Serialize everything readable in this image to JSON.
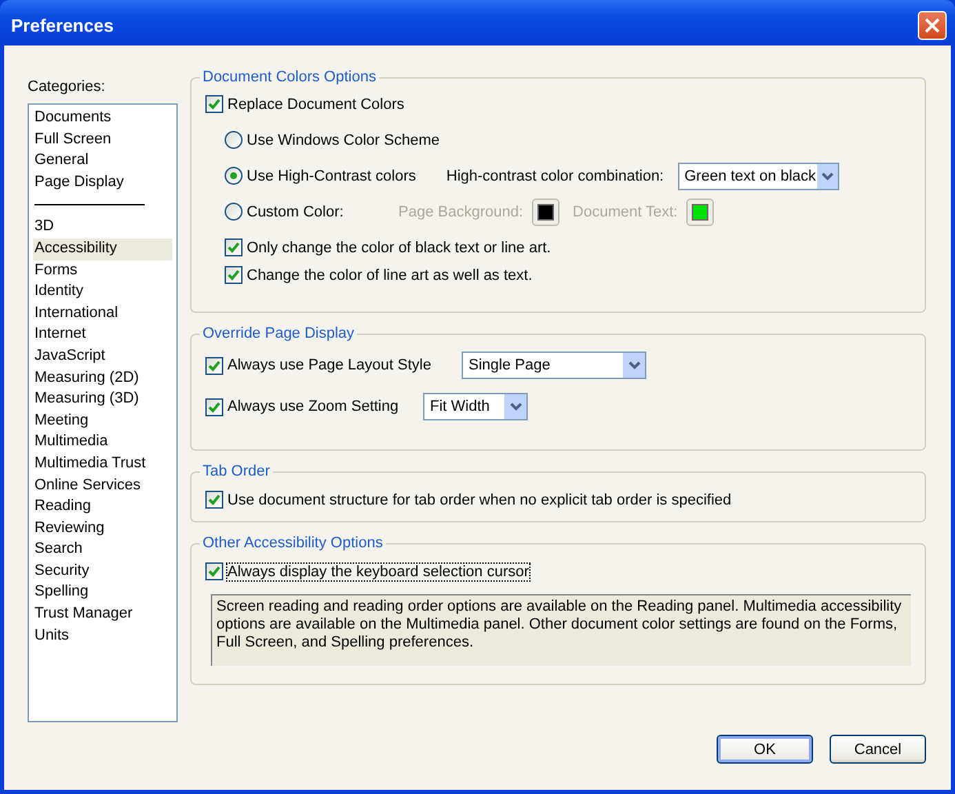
{
  "window": {
    "title": "Preferences"
  },
  "categories": {
    "label": "Categories:",
    "items": [
      {
        "kind": "item",
        "label": "Documents",
        "selected": false
      },
      {
        "kind": "item",
        "label": "Full Screen",
        "selected": false
      },
      {
        "kind": "item",
        "label": "General",
        "selected": false
      },
      {
        "kind": "item",
        "label": "Page Display",
        "selected": false
      },
      {
        "kind": "separator"
      },
      {
        "kind": "item",
        "label": "3D",
        "selected": false
      },
      {
        "kind": "item",
        "label": "Accessibility",
        "selected": true
      },
      {
        "kind": "item",
        "label": "Forms",
        "selected": false
      },
      {
        "kind": "item",
        "label": "Identity",
        "selected": false
      },
      {
        "kind": "item",
        "label": "International",
        "selected": false
      },
      {
        "kind": "item",
        "label": "Internet",
        "selected": false
      },
      {
        "kind": "item",
        "label": "JavaScript",
        "selected": false
      },
      {
        "kind": "item",
        "label": "Measuring (2D)",
        "selected": false
      },
      {
        "kind": "item",
        "label": "Measuring (3D)",
        "selected": false
      },
      {
        "kind": "item",
        "label": "Meeting",
        "selected": false
      },
      {
        "kind": "item",
        "label": "Multimedia",
        "selected": false
      },
      {
        "kind": "item",
        "label": "Multimedia Trust",
        "selected": false
      },
      {
        "kind": "item",
        "label": "Online Services",
        "selected": false
      },
      {
        "kind": "item",
        "label": "Reading",
        "selected": false
      },
      {
        "kind": "item",
        "label": "Reviewing",
        "selected": false
      },
      {
        "kind": "item",
        "label": "Search",
        "selected": false
      },
      {
        "kind": "item",
        "label": "Security",
        "selected": false
      },
      {
        "kind": "item",
        "label": "Spelling",
        "selected": false
      },
      {
        "kind": "item",
        "label": "Trust Manager",
        "selected": false
      },
      {
        "kind": "item",
        "label": "Units",
        "selected": false
      }
    ]
  },
  "document_colors": {
    "title": "Document Colors Options",
    "replace": {
      "label": "Replace Document Colors",
      "checked": true
    },
    "options": [
      {
        "label": "Use Windows Color Scheme",
        "selected": false
      },
      {
        "label": "Use High-Contrast colors",
        "selected": true,
        "combo_label": "High-contrast color combination:",
        "combo_value": "Green text on black"
      },
      {
        "label": "Custom Color:",
        "selected": false,
        "swatches": [
          {
            "label": "Page Background:",
            "color": "#000000",
            "disabled": true
          },
          {
            "label": "Document Text:",
            "color": "#00e000",
            "disabled": true
          }
        ]
      }
    ],
    "checks": [
      {
        "label": "Only change the color of black text or line art.",
        "checked": true
      },
      {
        "label": "Change the color of line art as well as text.",
        "checked": true
      }
    ]
  },
  "override": {
    "title": "Override Page Display",
    "rows": [
      {
        "label": "Always use Page Layout Style",
        "checked": true,
        "value": "Single Page"
      },
      {
        "label": "Always use Zoom Setting",
        "checked": true,
        "value": "Fit Width"
      }
    ]
  },
  "tab_order": {
    "title": "Tab Order",
    "checks": [
      {
        "label": "Use document structure for tab order when no explicit tab order is specified",
        "checked": true,
        "focused": false
      }
    ]
  },
  "other": {
    "title": "Other Accessibility Options",
    "checks": [
      {
        "label": "Always display the keyboard selection cursor",
        "checked": true,
        "focused": true
      }
    ],
    "note": "Screen reading and reading order options are available on the Reading panel. Multimedia accessibility options are available on the Multimedia panel. Other document color settings are found on the Forms, Full Screen, and Spelling preferences."
  },
  "buttons": [
    {
      "label": "OK",
      "default": true
    },
    {
      "label": "Cancel",
      "default": false
    }
  ]
}
